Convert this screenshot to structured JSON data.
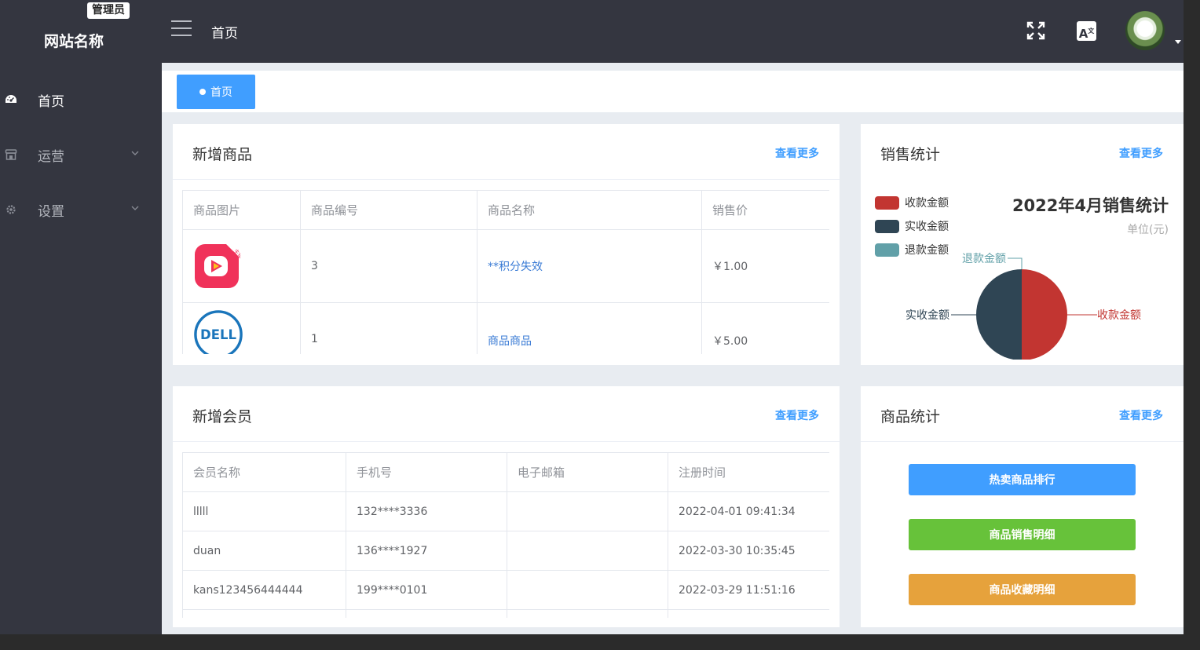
{
  "sidebar": {
    "badge": "管理员",
    "brand": "网站名称",
    "items": [
      {
        "label": "首页",
        "icon": "dashboard-icon",
        "active": true
      },
      {
        "label": "运营",
        "icon": "shop-icon",
        "expandable": true
      },
      {
        "label": "设置",
        "icon": "gear-icon",
        "expandable": true
      }
    ]
  },
  "header": {
    "title": "首页",
    "translate_glyph": "A",
    "translate_sup": "文"
  },
  "tabs": [
    {
      "label": "首页",
      "active": true
    }
  ],
  "new_products": {
    "title": "新增商品",
    "more": "查看更多",
    "columns": [
      "商品图片",
      "商品编号",
      "商品名称",
      "销售价"
    ],
    "rows": [
      {
        "image": "zhubo-app-logo",
        "id": "3",
        "name": "**积分失效",
        "price": "￥1.00"
      },
      {
        "image": "dell-logo",
        "id": "1",
        "name": "商品商品",
        "price": "￥5.00"
      }
    ]
  },
  "sales_stats": {
    "title": "销售统计",
    "more": "查看更多",
    "legend": [
      {
        "label": "收款金额",
        "color": "#c23531"
      },
      {
        "label": "实收金额",
        "color": "#2f4554"
      },
      {
        "label": "退款金额",
        "color": "#61a0a8"
      }
    ]
  },
  "chart_data": {
    "type": "pie",
    "title": "2022年4月销售统计",
    "subtitle": "单位(元)",
    "legend_position": "top-left",
    "slices": [
      {
        "name": "收款金额",
        "value": 1,
        "color": "#c23531"
      },
      {
        "name": "实收金额",
        "value": 1,
        "color": "#2f4554"
      },
      {
        "name": "退款金额",
        "value": 0,
        "color": "#61a0a8"
      }
    ]
  },
  "new_members": {
    "title": "新增会员",
    "more": "查看更多",
    "columns": [
      "会员名称",
      "手机号",
      "电子邮箱",
      "注册时间"
    ],
    "rows": [
      {
        "name": "lllll",
        "phone": "132****3336",
        "email": "",
        "registered": "2022-04-01 09:41:34"
      },
      {
        "name": "duan",
        "phone": "136****1927",
        "email": "",
        "registered": "2022-03-30 10:35:45"
      },
      {
        "name": "kans123456444444",
        "phone": "199****0101",
        "email": "",
        "registered": "2022-03-29 11:51:16"
      }
    ]
  },
  "product_stats": {
    "title": "商品统计",
    "more": "查看更多",
    "buttons": [
      {
        "label": "热卖商品排行",
        "color": "#409eff"
      },
      {
        "label": "商品销售明细",
        "color": "#67c23a"
      },
      {
        "label": "商品收藏明细",
        "color": "#e6a23c"
      }
    ]
  }
}
